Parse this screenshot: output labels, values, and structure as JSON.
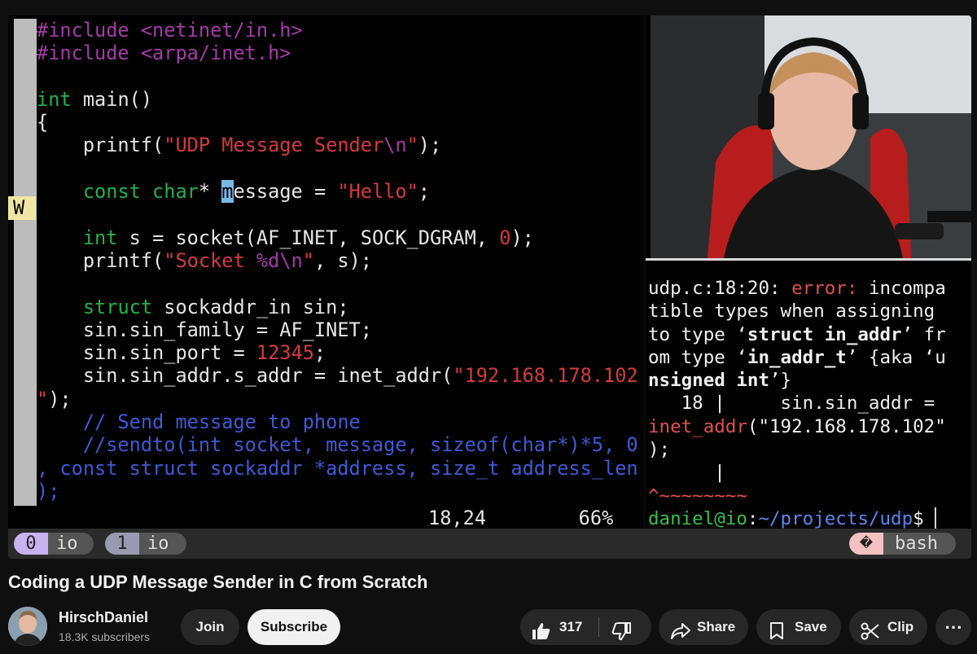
{
  "editor": {
    "lines": [
      {
        "segs": [
          {
            "t": "#include ",
            "c": "pp"
          },
          {
            "t": "<netinet/in.h>",
            "c": "pp"
          }
        ]
      },
      {
        "segs": [
          {
            "t": "#include ",
            "c": "pp"
          },
          {
            "t": "<arpa/inet.h>",
            "c": "pp"
          }
        ]
      },
      {
        "segs": []
      },
      {
        "segs": [
          {
            "t": "int",
            "c": "kw"
          },
          {
            "t": " main()"
          }
        ]
      },
      {
        "segs": [
          {
            "t": "{"
          }
        ]
      },
      {
        "segs": [
          {
            "t": "    printf("
          },
          {
            "t": "\"UDP Message Sender",
            "c": "str"
          },
          {
            "t": "\\n",
            "c": "pp"
          },
          {
            "t": "\"",
            "c": "str"
          },
          {
            "t": ");"
          }
        ]
      },
      {
        "segs": []
      },
      {
        "segs": [
          {
            "t": "    "
          },
          {
            "t": "const char",
            "c": "kw"
          },
          {
            "t": "* "
          },
          {
            "t": "m",
            "c": "cur"
          },
          {
            "t": "essage = "
          },
          {
            "t": "\"Hello\"",
            "c": "str"
          },
          {
            "t": ";"
          }
        ]
      },
      {
        "segs": []
      },
      {
        "segs": [
          {
            "t": "    "
          },
          {
            "t": "int",
            "c": "kw"
          },
          {
            "t": " s = socket(AF_INET, SOCK_DGRAM, "
          },
          {
            "t": "0",
            "c": "str"
          },
          {
            "t": ");"
          }
        ]
      },
      {
        "segs": [
          {
            "t": "    printf("
          },
          {
            "t": "\"Socket ",
            "c": "str"
          },
          {
            "t": "%d\\n",
            "c": "pp"
          },
          {
            "t": "\"",
            "c": "str"
          },
          {
            "t": ", s);"
          }
        ]
      },
      {
        "segs": []
      },
      {
        "segs": [
          {
            "t": "    "
          },
          {
            "t": "struct",
            "c": "kw"
          },
          {
            "t": " sockaddr_in sin;"
          }
        ]
      },
      {
        "segs": [
          {
            "t": "    sin.sin_family = AF_INET;"
          }
        ]
      },
      {
        "segs": [
          {
            "t": "    sin.sin_port = "
          },
          {
            "t": "12345",
            "c": "str"
          },
          {
            "t": ";"
          }
        ]
      },
      {
        "segs": [
          {
            "t": "    sin.sin_addr.s_addr = inet_addr("
          },
          {
            "t": "\"192.168.178.102",
            "c": "str"
          }
        ]
      },
      {
        "segs": [
          {
            "t": "\"",
            "c": "str"
          },
          {
            "t": ");"
          }
        ]
      },
      {
        "segs": [
          {
            "t": "    // Send message to phone",
            "c": "cm"
          }
        ]
      },
      {
        "segs": [
          {
            "t": "    //sendto(int socket, message, sizeof(char*)*5, 0",
            "c": "cm"
          }
        ]
      },
      {
        "segs": [
          {
            "t": ", const struct sockaddr *address, size_t address_len",
            "c": "cm"
          }
        ]
      },
      {
        "segs": [
          {
            "t": ");",
            "c": "cm"
          }
        ]
      }
    ],
    "mode_marker": "W",
    "ruler_pos": "18,24",
    "ruler_pct": "66%"
  },
  "terminal": {
    "lines": [
      {
        "segs": [
          {
            "t": "udp.c:18:20: "
          },
          {
            "t": "error:",
            "c": "err"
          },
          {
            "t": " incompa"
          }
        ]
      },
      {
        "segs": [
          {
            "t": "tible types when assigning"
          }
        ]
      },
      {
        "segs": [
          {
            "t": "to type ‘"
          },
          {
            "t": "struct in_addr",
            "c": "b"
          },
          {
            "t": "’ fr"
          }
        ]
      },
      {
        "segs": [
          {
            "t": "om type ‘"
          },
          {
            "t": "in_addr_t",
            "c": "b"
          },
          {
            "t": "’ {aka ‘u"
          }
        ]
      },
      {
        "segs": [
          {
            "t": "nsigned int",
            "c": "b"
          },
          {
            "t": "’}"
          }
        ]
      },
      {
        "segs": [
          {
            "t": "   18 |     sin.sin_addr ="
          }
        ]
      },
      {
        "segs": [
          {
            "t": "inet_addr",
            "c": "err"
          },
          {
            "t": "(\"192.168.178.102\""
          }
        ]
      },
      {
        "segs": [
          {
            "t": ");"
          }
        ]
      },
      {
        "segs": [
          {
            "t": "      |"
          }
        ]
      },
      {
        "segs": [
          {
            "t": "^~~~~~~~~",
            "c": "err"
          }
        ]
      },
      {
        "segs": [
          {
            "t": "daniel@io",
            "c": "pr-user"
          },
          {
            "t": ":"
          },
          {
            "t": "~/projects/udp",
            "c": "pr-path"
          },
          {
            "t": "$ ▏"
          }
        ]
      }
    ]
  },
  "tmux": {
    "tabs": [
      {
        "num": "0",
        "name": "io",
        "color": "#c9b2f0"
      },
      {
        "num": "1",
        "name": "io",
        "color": "#9a9ab3"
      }
    ],
    "right_icon": "�",
    "right_label": "bash"
  },
  "video": {
    "title": "Coding a UDP Message Sender in C from Scratch",
    "channel": "HirschDaniel",
    "subscribers": "18.3K subscribers",
    "join": "Join",
    "subscribe": "Subscribe",
    "likes": "317",
    "share": "Share",
    "save": "Save",
    "clip": "Clip",
    "more": "⋯"
  }
}
